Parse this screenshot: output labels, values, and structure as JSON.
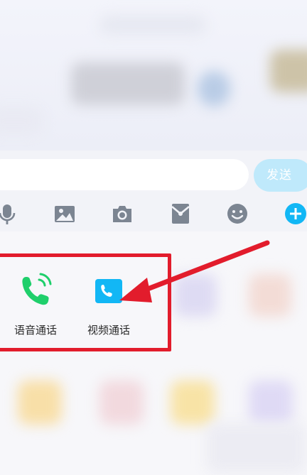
{
  "composer": {
    "input_value": "",
    "input_placeholder": "",
    "send_label": "发送"
  },
  "toolbar": {
    "icons": [
      "microphone-icon",
      "image-icon",
      "camera-icon",
      "red-packet-icon",
      "emoji-icon",
      "plus-icon"
    ]
  },
  "features": {
    "voice_call_label": "语音通话",
    "video_call_label": "视频通话"
  },
  "colors": {
    "accent": "#12b7f5",
    "send_button": "#bfe9fb",
    "voice_call_green": "#1fcf6b",
    "highlight_red": "#e21c2c"
  }
}
